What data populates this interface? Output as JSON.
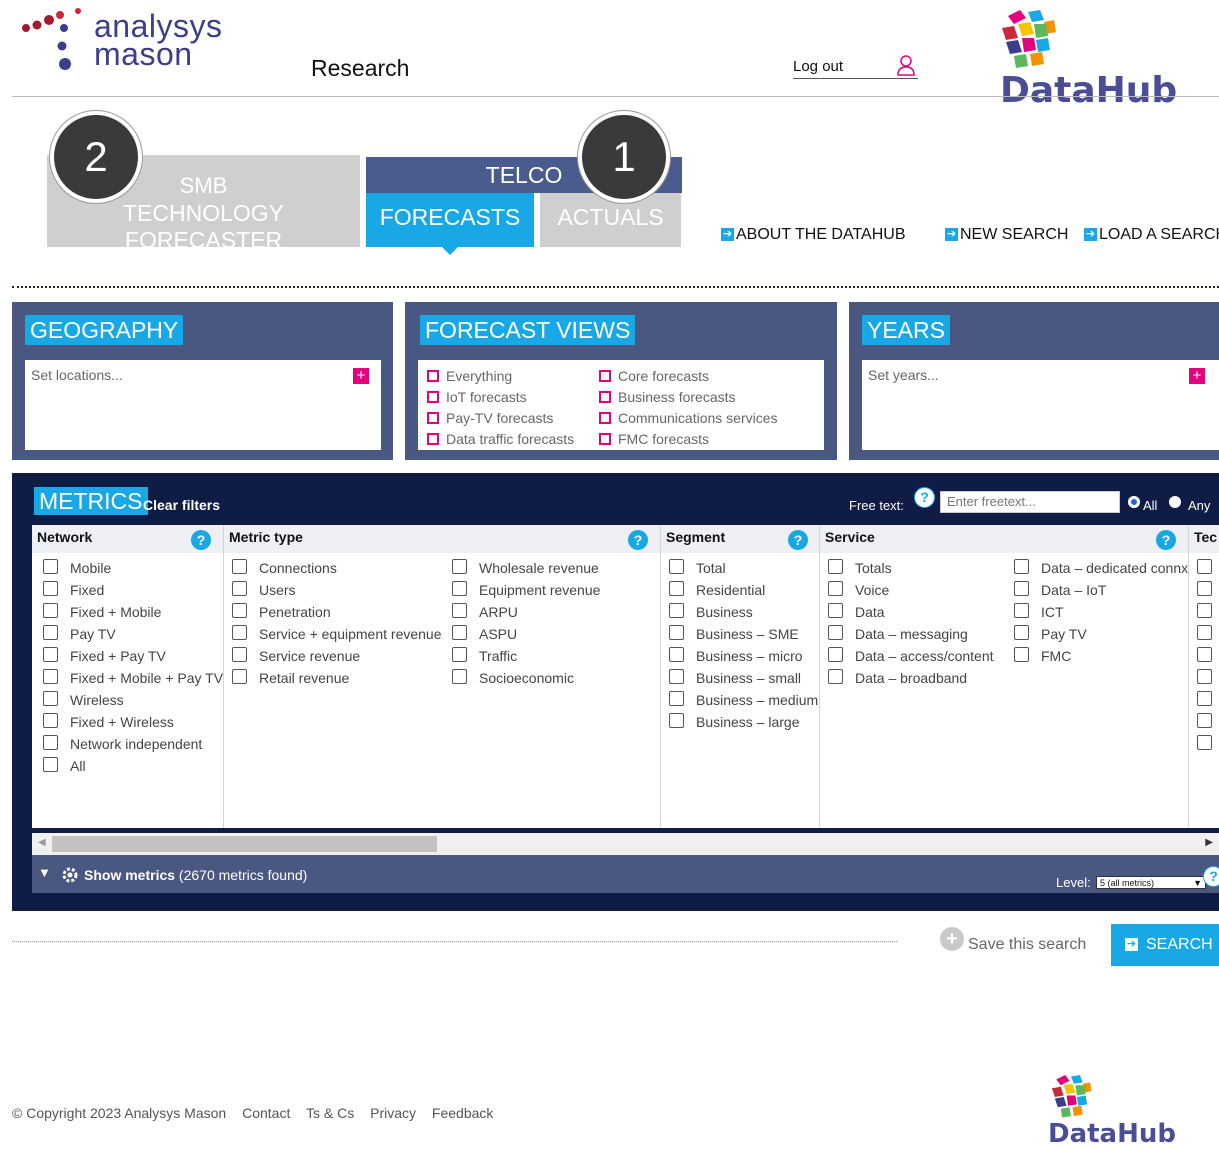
{
  "header": {
    "brand_line1": "analysys",
    "brand_line2": "mason",
    "section": "Research",
    "logout_label": "Log out",
    "product_name": "DataHub"
  },
  "tabs": {
    "smb_line1": "SMB",
    "smb_line2": "TECHNOLOGY FORECASTER",
    "telco": "TELCO",
    "forecasts": "FORECASTS",
    "actuals": "ACTUALS",
    "badge_1": "1",
    "badge_2": "2"
  },
  "top_links": {
    "about": "ABOUT THE DATAHUB",
    "new_search": "NEW SEARCH",
    "load_search": "LOAD A SEARCH"
  },
  "geography": {
    "title": "GEOGRAPHY",
    "placeholder": "Set locations..."
  },
  "forecast_views": {
    "title": "FORECAST VIEWS",
    "items": [
      "Everything",
      "IoT forecasts",
      "Pay-TV forecasts",
      "Data traffic forecasts",
      "Core forecasts",
      "Business forecasts",
      "Communications services",
      "FMC forecasts"
    ]
  },
  "years": {
    "title": "YEARS",
    "placeholder": "Set years..."
  },
  "metrics": {
    "title": "METRICS",
    "clear_filters": "Clear filters",
    "free_text_label": "Free text:",
    "free_text_placeholder": "Enter freetext...",
    "radio_all": "All",
    "radio_any": "Any",
    "radio_selected": "All",
    "columns": {
      "network": {
        "header": "Network",
        "items": [
          "Mobile",
          "Fixed",
          "Fixed + Mobile",
          "Pay TV",
          "Fixed + Pay TV",
          "Fixed + Mobile + Pay TV",
          "Wireless",
          "Fixed + Wireless",
          "Network independent",
          "All"
        ]
      },
      "metric_type": {
        "header": "Metric type",
        "items": [
          "Connections",
          "Users",
          "Penetration",
          "Service + equipment revenue",
          "Service revenue",
          "Retail revenue",
          "Wholesale revenue",
          "Equipment revenue",
          "ARPU",
          "ASPU",
          "Traffic",
          "Socioeconomic"
        ]
      },
      "segment": {
        "header": "Segment",
        "items": [
          "Total",
          "Residential",
          "Business",
          "Business – SME",
          "Business – micro",
          "Business – small",
          "Business – medium",
          "Business – large"
        ]
      },
      "service": {
        "header": "Service",
        "items": [
          "Totals",
          "Voice",
          "Data",
          "Data – messaging",
          "Data – access/content",
          "Data – broadband",
          "Data – dedicated connx",
          "Data – IoT",
          "ICT",
          "Pay TV",
          "FMC"
        ]
      },
      "technology": {
        "header": "Tec"
      }
    },
    "show_metrics_label": "Show metrics",
    "metrics_found": "(2670 metrics found)",
    "level_label": "Level:",
    "level_value": "5 (all metrics)"
  },
  "bottom": {
    "save_label": "Save this search",
    "search_label": "SEARCH"
  },
  "footer": {
    "copyright": "© Copyright 2023 Analysys Mason",
    "links": [
      "Contact",
      "Ts & Cs",
      "Privacy",
      "Feedback"
    ]
  },
  "colors": {
    "accent_blue": "#19a8e6",
    "navy": "#0f1c45",
    "panel_slate": "#4a5780",
    "magenta": "#e5007d",
    "inactive_grey": "#cfcfcf"
  }
}
